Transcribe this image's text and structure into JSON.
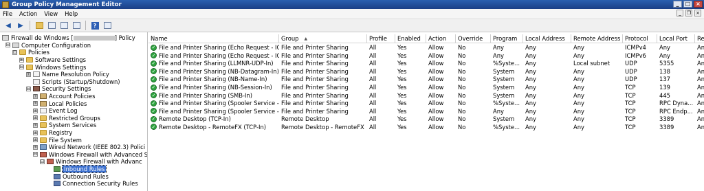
{
  "window": {
    "title": "Group Policy Management Editor",
    "min": "_",
    "max": "□",
    "close": "×"
  },
  "menu": [
    "File",
    "Action",
    "View",
    "Help"
  ],
  "tree": {
    "root_prefix": "Firewall de Windows [",
    "root_suffix": "] Policy",
    "items": [
      {
        "label": "Computer Configuration",
        "indent": 0,
        "exp": "⊟",
        "icon": "gpo"
      },
      {
        "label": "Policies",
        "indent": 1,
        "exp": "⊟",
        "icon": "folder"
      },
      {
        "label": "Software Settings",
        "indent": 2,
        "exp": "⊞",
        "icon": "folder"
      },
      {
        "label": "Windows Settings",
        "indent": 2,
        "exp": "⊟",
        "icon": "folder"
      },
      {
        "label": "Name Resolution Policy",
        "indent": 3,
        "exp": "⊞",
        "icon": "doc"
      },
      {
        "label": "Scripts (Startup/Shutdown)",
        "indent": 3,
        "exp": "",
        "icon": "doc"
      },
      {
        "label": "Security Settings",
        "indent": 3,
        "exp": "⊟",
        "icon": "shield"
      },
      {
        "label": "Account Policies",
        "indent": 4,
        "exp": "⊞",
        "icon": "keyi"
      },
      {
        "label": "Local Policies",
        "indent": 4,
        "exp": "⊞",
        "icon": "keyi"
      },
      {
        "label": "Event Log",
        "indent": 4,
        "exp": "⊞",
        "icon": "doc"
      },
      {
        "label": "Restricted Groups",
        "indent": 4,
        "exp": "⊞",
        "icon": "folder"
      },
      {
        "label": "System Services",
        "indent": 4,
        "exp": "⊞",
        "icon": "folder"
      },
      {
        "label": "Registry",
        "indent": 4,
        "exp": "⊞",
        "icon": "folder"
      },
      {
        "label": "File System",
        "indent": 4,
        "exp": "⊞",
        "icon": "folder"
      },
      {
        "label": "Wired Network (IEEE 802.3) Polici",
        "indent": 4,
        "exp": "⊞",
        "icon": "net"
      },
      {
        "label": "Windows Firewall with Advanced S",
        "indent": 4,
        "exp": "⊟",
        "icon": "fw"
      },
      {
        "label": "Windows Firewall with Advanc",
        "indent": 5,
        "exp": "⊟",
        "icon": "fw"
      },
      {
        "label": "Inbound Rules",
        "indent": 6,
        "exp": "",
        "icon": "rules-in",
        "selected": true
      },
      {
        "label": "Outbound Rules",
        "indent": 6,
        "exp": "",
        "icon": "rules-out"
      },
      {
        "label": "Connection Security Rules",
        "indent": 6,
        "exp": "",
        "icon": "rules-out"
      }
    ]
  },
  "columns": [
    "Name",
    "Group",
    "Profile",
    "Enabled",
    "Action",
    "Override",
    "Program",
    "Local Address",
    "Remote Address",
    "Protocol",
    "Local Port",
    "Re"
  ],
  "sorted_column_marker": "▲",
  "rows": [
    [
      "File and Printer Sharing (Echo Request - ICM...",
      "File and Printer Sharing",
      "All",
      "Yes",
      "Allow",
      "No",
      "Any",
      "Any",
      "Any",
      "ICMPv4",
      "Any",
      "An"
    ],
    [
      "File and Printer Sharing (Echo Request - ICM...",
      "File and Printer Sharing",
      "All",
      "Yes",
      "Allow",
      "No",
      "Any",
      "Any",
      "Any",
      "ICMPv6",
      "Any",
      "An"
    ],
    [
      "File and Printer Sharing (LLMNR-UDP-In)",
      "File and Printer Sharing",
      "All",
      "Yes",
      "Allow",
      "No",
      "%Syste...",
      "Any",
      "Local subnet",
      "UDP",
      "5355",
      "An"
    ],
    [
      "File and Printer Sharing (NB-Datagram-In)",
      "File and Printer Sharing",
      "All",
      "Yes",
      "Allow",
      "No",
      "System",
      "Any",
      "Any",
      "UDP",
      "138",
      "An"
    ],
    [
      "File and Printer Sharing (NB-Name-In)",
      "File and Printer Sharing",
      "All",
      "Yes",
      "Allow",
      "No",
      "System",
      "Any",
      "Any",
      "UDP",
      "137",
      "An"
    ],
    [
      "File and Printer Sharing (NB-Session-In)",
      "File and Printer Sharing",
      "All",
      "Yes",
      "Allow",
      "No",
      "System",
      "Any",
      "Any",
      "TCP",
      "139",
      "An"
    ],
    [
      "File and Printer Sharing (SMB-In)",
      "File and Printer Sharing",
      "All",
      "Yes",
      "Allow",
      "No",
      "System",
      "Any",
      "Any",
      "TCP",
      "445",
      "An"
    ],
    [
      "File and Printer Sharing (Spooler Service - RPC)",
      "File and Printer Sharing",
      "All",
      "Yes",
      "Allow",
      "No",
      "%Syste...",
      "Any",
      "Any",
      "TCP",
      "RPC Dyna...",
      "An"
    ],
    [
      "File and Printer Sharing (Spooler Service - R...",
      "File and Printer Sharing",
      "All",
      "Yes",
      "Allow",
      "No",
      "Any",
      "Any",
      "Any",
      "TCP",
      "RPC Endp...",
      "An"
    ],
    [
      "Remote Desktop (TCP-In)",
      "Remote Desktop",
      "All",
      "Yes",
      "Allow",
      "No",
      "System",
      "Any",
      "Any",
      "TCP",
      "3389",
      "An"
    ],
    [
      "Remote Desktop - RemoteFX (TCP-In)",
      "Remote Desktop - RemoteFX",
      "All",
      "Yes",
      "Allow",
      "No",
      "%Syste...",
      "Any",
      "Any",
      "TCP",
      "3389",
      "An"
    ]
  ],
  "icons": {
    "rule_enabled": "check-circle-icon",
    "back": "back-arrow-icon",
    "forward": "forward-arrow-icon"
  },
  "colors": {
    "titlebar": "#1f4a9a",
    "selection": "#3a6fcf",
    "enabled_check": "#2fa640"
  }
}
